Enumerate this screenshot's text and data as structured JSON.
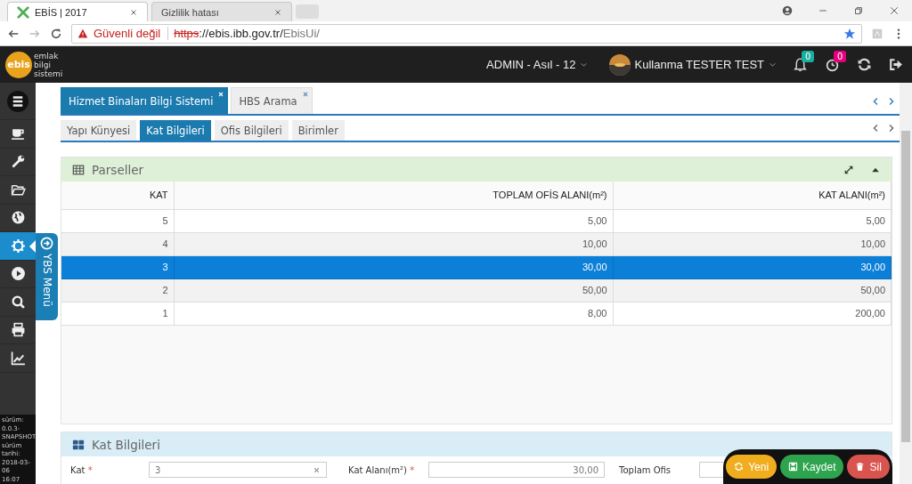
{
  "browser": {
    "tabs": [
      {
        "title": "EBİS | 2017",
        "selected": true
      },
      {
        "title": "Gizlilik hatası",
        "selected": false
      }
    ],
    "address": {
      "security": "Güvenli değil",
      "scheme": "https",
      "host": "://ebis.ibb.gov.tr/",
      "path": "EbisUi/"
    }
  },
  "header": {
    "logo": {
      "mark": "ebis",
      "lines": [
        "emlak",
        "bilgi",
        "sistemi"
      ]
    },
    "role": "ADMIN - Asıl - 12",
    "user": "Kullanma TESTER TEST",
    "badges": [
      {
        "count": "0",
        "color": "#1aae9f"
      },
      {
        "count": "0",
        "color": "#e6007e"
      }
    ]
  },
  "sidebar": {
    "items": [
      {
        "selected": false
      },
      {
        "selected": false
      },
      {
        "selected": false
      },
      {
        "selected": false
      },
      {
        "selected": false
      },
      {
        "selected": true
      },
      {
        "selected": false
      },
      {
        "selected": false
      },
      {
        "selected": false
      },
      {
        "selected": false
      }
    ],
    "version": [
      "sürüm:",
      "0.0.3-",
      "SNAPSHOT",
      "sürüm tarihi:",
      "2018-03-06",
      "16:07"
    ]
  },
  "side_menu_tab": "YBS Menü",
  "module_tabs": [
    {
      "label": "Hizmet Binaları Bilgi Sistemi",
      "selected": true
    },
    {
      "label": "HBS Arama",
      "selected": false
    }
  ],
  "sub_tabs": [
    {
      "label": "Yapı Künyesi",
      "selected": false
    },
    {
      "label": "Kat Bilgileri",
      "selected": true
    },
    {
      "label": "Ofis Bilgileri",
      "selected": false
    },
    {
      "label": "Birimler",
      "selected": false
    }
  ],
  "table_panel": {
    "title": "Parseller",
    "columns": [
      "KAT",
      "TOPLAM OFİS ALANI(m²)",
      "KAT ALANI(m²)"
    ],
    "rows": [
      {
        "cells": [
          "5",
          "5,00",
          "5,00"
        ],
        "selected": false
      },
      {
        "cells": [
          "4",
          "10,00",
          "10,00"
        ],
        "selected": false
      },
      {
        "cells": [
          "3",
          "30,00",
          "30,00"
        ],
        "selected": true
      },
      {
        "cells": [
          "2",
          "50,00",
          "50,00"
        ],
        "selected": false
      },
      {
        "cells": [
          "1",
          "8,00",
          "200,00"
        ],
        "selected": false
      }
    ]
  },
  "form_panel": {
    "title": "Kat Bilgileri",
    "fields": [
      {
        "label": "Kat",
        "required_mark": "*",
        "kind": "select",
        "value": "3"
      },
      {
        "label": "Kat Alanı(m²)",
        "required_mark": "*",
        "kind": "number",
        "value": "30,00"
      },
      {
        "label": "Toplam Ofis",
        "kind": "cut"
      }
    ]
  },
  "actions": [
    {
      "label": "Yeni",
      "kind": "new"
    },
    {
      "label": "Kaydet",
      "kind": "save"
    },
    {
      "label": "Sil",
      "kind": "delete"
    }
  ]
}
